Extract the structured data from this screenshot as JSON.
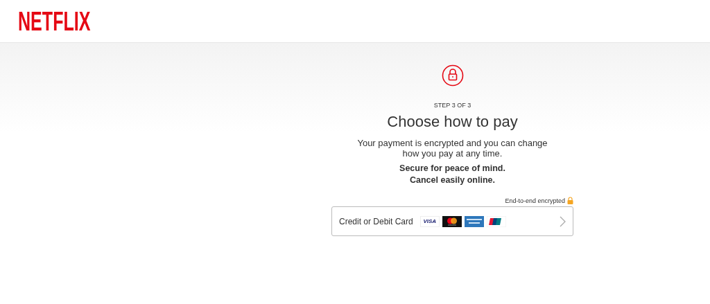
{
  "header": {
    "logo": "NETFLIX"
  },
  "step": "STEP 3 OF 3",
  "title": "Choose how to pay",
  "description": "Your payment is encrypted and you can change how you pay at any time.",
  "assurances": [
    "Secure for peace of mind.",
    "Cancel easily online."
  ],
  "encryption_note": "End-to-end encrypted",
  "payment_option": {
    "label": "Credit or Debit Card",
    "card_logos": [
      {
        "kind": "visa",
        "text": "VISA"
      },
      {
        "kind": "mastercard"
      },
      {
        "kind": "amex"
      },
      {
        "kind": "unionpay"
      }
    ]
  }
}
